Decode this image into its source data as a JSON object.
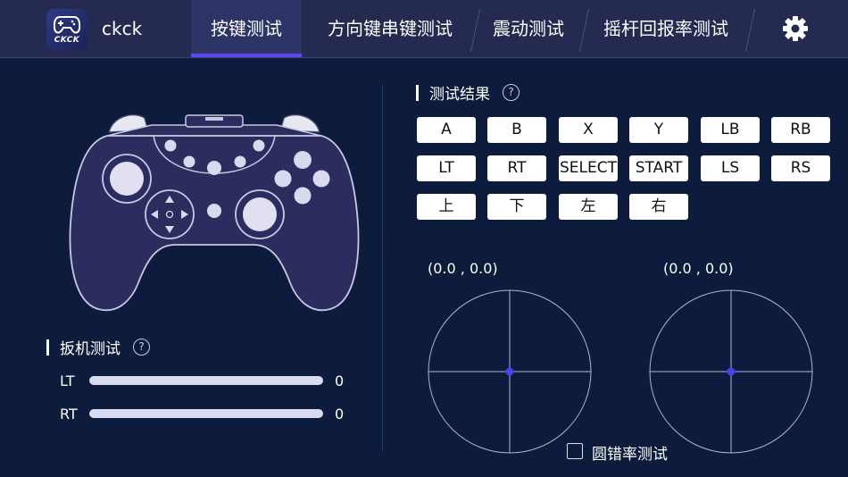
{
  "app": {
    "name": "ckck",
    "logo_text": "CKCK"
  },
  "tabs": [
    {
      "label": "按键测试",
      "active": true
    },
    {
      "label": "方向键串键测试",
      "active": false
    },
    {
      "label": "震动测试",
      "active": false
    },
    {
      "label": "摇杆回报率测试",
      "active": false
    }
  ],
  "settings_icon": "gear-icon",
  "results": {
    "title": "测试结果",
    "help": "?",
    "buttons": [
      "A",
      "B",
      "X",
      "Y",
      "LB",
      "RB",
      "LT",
      "RT",
      "SELECT",
      "START",
      "LS",
      "RS",
      "上",
      "下",
      "左",
      "右"
    ]
  },
  "trigger": {
    "title": "扳机测试",
    "help": "?",
    "rows": [
      {
        "label": "LT",
        "value": "0"
      },
      {
        "label": "RT",
        "value": "0"
      }
    ]
  },
  "joysticks": {
    "left": {
      "coord": "(0.0 , 0.0)"
    },
    "right": {
      "coord": "(0.0 , 0.0)"
    }
  },
  "roundness_test": {
    "label": "圆错率测试",
    "checked": false
  },
  "colors": {
    "background": "#0d1c3c",
    "topbar": "#242a50",
    "accent": "#5b46f0",
    "stick_dot": "#4b3ff0"
  }
}
